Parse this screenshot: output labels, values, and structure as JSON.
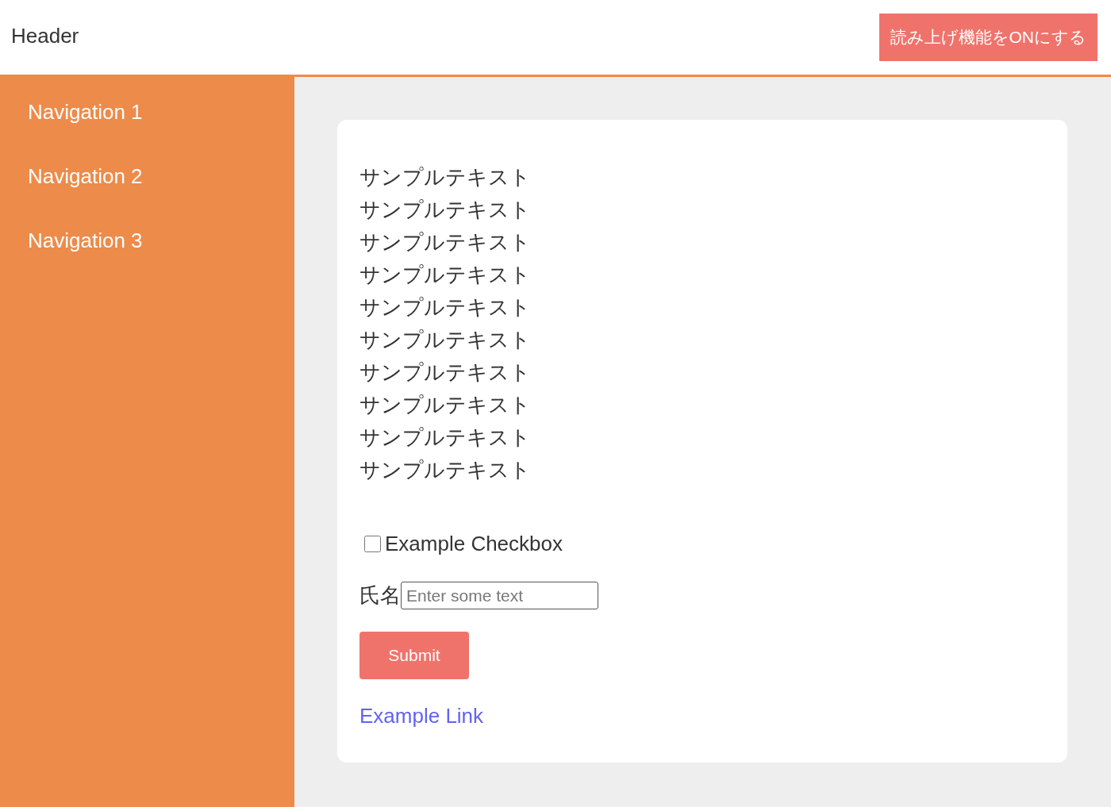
{
  "header": {
    "title": "Header",
    "read_aloud_button": "読み上げ機能をONにする"
  },
  "sidebar": {
    "items": [
      {
        "label": "Navigation 1"
      },
      {
        "label": "Navigation 2"
      },
      {
        "label": "Navigation 3"
      }
    ]
  },
  "content": {
    "texts": [
      "サンプルテキスト",
      "サンプルテキスト",
      "サンプルテキスト",
      "サンプルテキスト",
      "サンプルテキスト",
      "サンプルテキスト",
      "サンプルテキスト",
      "サンプルテキスト",
      "サンプルテキスト",
      "サンプルテキスト"
    ],
    "checkbox": {
      "label": "Example Checkbox",
      "checked": false
    },
    "name_field": {
      "label": "氏名",
      "placeholder": "Enter some text"
    },
    "submit_button": "Submit",
    "link": "Example Link"
  }
}
